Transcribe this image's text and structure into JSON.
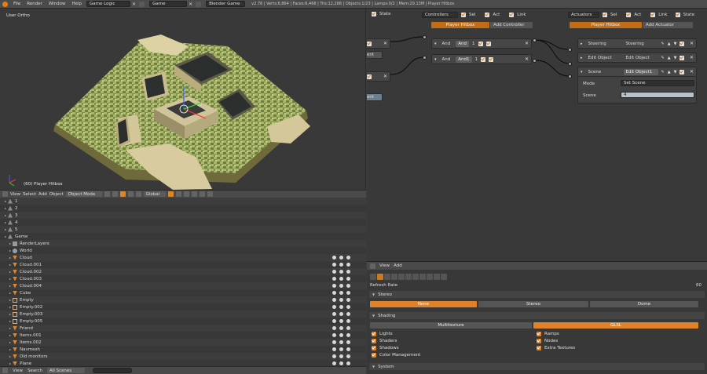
{
  "topbar": {
    "menus": [
      "File",
      "Render",
      "Window",
      "Help"
    ],
    "screen_layout": "Game Logic",
    "scene": "Game",
    "engine": "Blender Game",
    "status": "v2.76 | Verts:6,864 | Faces:6,468 | Tris:12,288 | Objects:1/23 | Lamps:0/2 | Mem:29.13M | Player Hitbox"
  },
  "viewport": {
    "view_label": "User Ortho",
    "object_label": "(60) Player Hitbox"
  },
  "view_header": {
    "menus": [
      "View",
      "Select",
      "Add",
      "Object"
    ],
    "mode": "Object Mode",
    "orientation": "Global"
  },
  "outliner": {
    "rows": [
      {
        "label": "1",
        "icon": "scene-icon"
      },
      {
        "label": "2",
        "icon": "scene-icon"
      },
      {
        "label": "3",
        "icon": "scene-icon"
      },
      {
        "label": "4",
        "icon": "scene-icon"
      },
      {
        "label": "5",
        "icon": "scene-icon"
      },
      {
        "label": "Game",
        "icon": "scene-icon"
      },
      {
        "label": "RenderLayers",
        "icon": "render-layers-icon"
      },
      {
        "label": "World",
        "icon": "world-icon"
      },
      {
        "label": "Cloud",
        "icon": "object-icon"
      },
      {
        "label": "Cloud.001",
        "icon": "object-icon"
      },
      {
        "label": "Cloud.002",
        "icon": "object-icon"
      },
      {
        "label": "Cloud.003",
        "icon": "object-icon"
      },
      {
        "label": "Cloud.004",
        "icon": "object-icon"
      },
      {
        "label": "Cube",
        "icon": "object-icon"
      },
      {
        "label": "Empty",
        "icon": "empty-icon"
      },
      {
        "label": "Empty.002",
        "icon": "empty-icon"
      },
      {
        "label": "Empty.003",
        "icon": "empty-icon"
      },
      {
        "label": "Empty.005",
        "icon": "empty-icon"
      },
      {
        "label": "Friend",
        "icon": "object-icon"
      },
      {
        "label": "Items.001",
        "icon": "object-icon"
      },
      {
        "label": "Items.002",
        "icon": "object-icon"
      },
      {
        "label": "Navmesh",
        "icon": "object-icon"
      },
      {
        "label": "Old monitors",
        "icon": "object-icon"
      },
      {
        "label": "Plane",
        "icon": "object-icon"
      }
    ]
  },
  "outliner_footer": {
    "menus": [
      "View",
      "Search"
    ],
    "display": "All Scenes"
  },
  "logic": {
    "sensors_header": {
      "state": "State"
    },
    "controllers_header": {
      "label": "Controllers",
      "sel": "Sel",
      "act": "Act",
      "link": "Link",
      "object": "Player Hitbox",
      "add": "Add Controller"
    },
    "actuators_header": {
      "label": "Actuators",
      "sel": "Sel",
      "act": "Act",
      "link": "Link",
      "state": "State",
      "object": "Player Hitbox",
      "add": "Add Actuator"
    },
    "sensor_partial": [
      "ent",
      "ent"
    ],
    "controllers": [
      {
        "type": "And",
        "name": "And",
        "state": "1"
      },
      {
        "type": "And",
        "name": "And1",
        "state": "1"
      }
    ],
    "actuators": [
      {
        "type": "Steering",
        "name": "Steering"
      },
      {
        "type": "Edit Object",
        "name": "Edit Object"
      },
      {
        "type": "Scene",
        "name": "Edit Object1",
        "mode_label": "Mode",
        "mode": "Set Scene",
        "scene_label": "Scene",
        "scene": "4"
      }
    ]
  },
  "props": {
    "header_menus": [
      "View",
      "Add"
    ],
    "refresh_label": "Refresh Rate",
    "refresh_value": "60",
    "stereo": {
      "title": "Stereo",
      "options": [
        "None",
        "Stereo",
        "Dome"
      ],
      "selected": "None"
    },
    "shading": {
      "title": "Shading",
      "options": [
        "Multitexture",
        "GLSL"
      ],
      "selected": "GLSL"
    },
    "checks_left": [
      "Lights",
      "Shaders",
      "Shadows",
      "Color Management"
    ],
    "checks_right": [
      "Ramps",
      "Nodes",
      "Extra Textures"
    ],
    "system": {
      "title": "System"
    }
  },
  "colors": {
    "accent": "#e0822a",
    "panel": "#393939",
    "header": "#4a4a4a"
  }
}
